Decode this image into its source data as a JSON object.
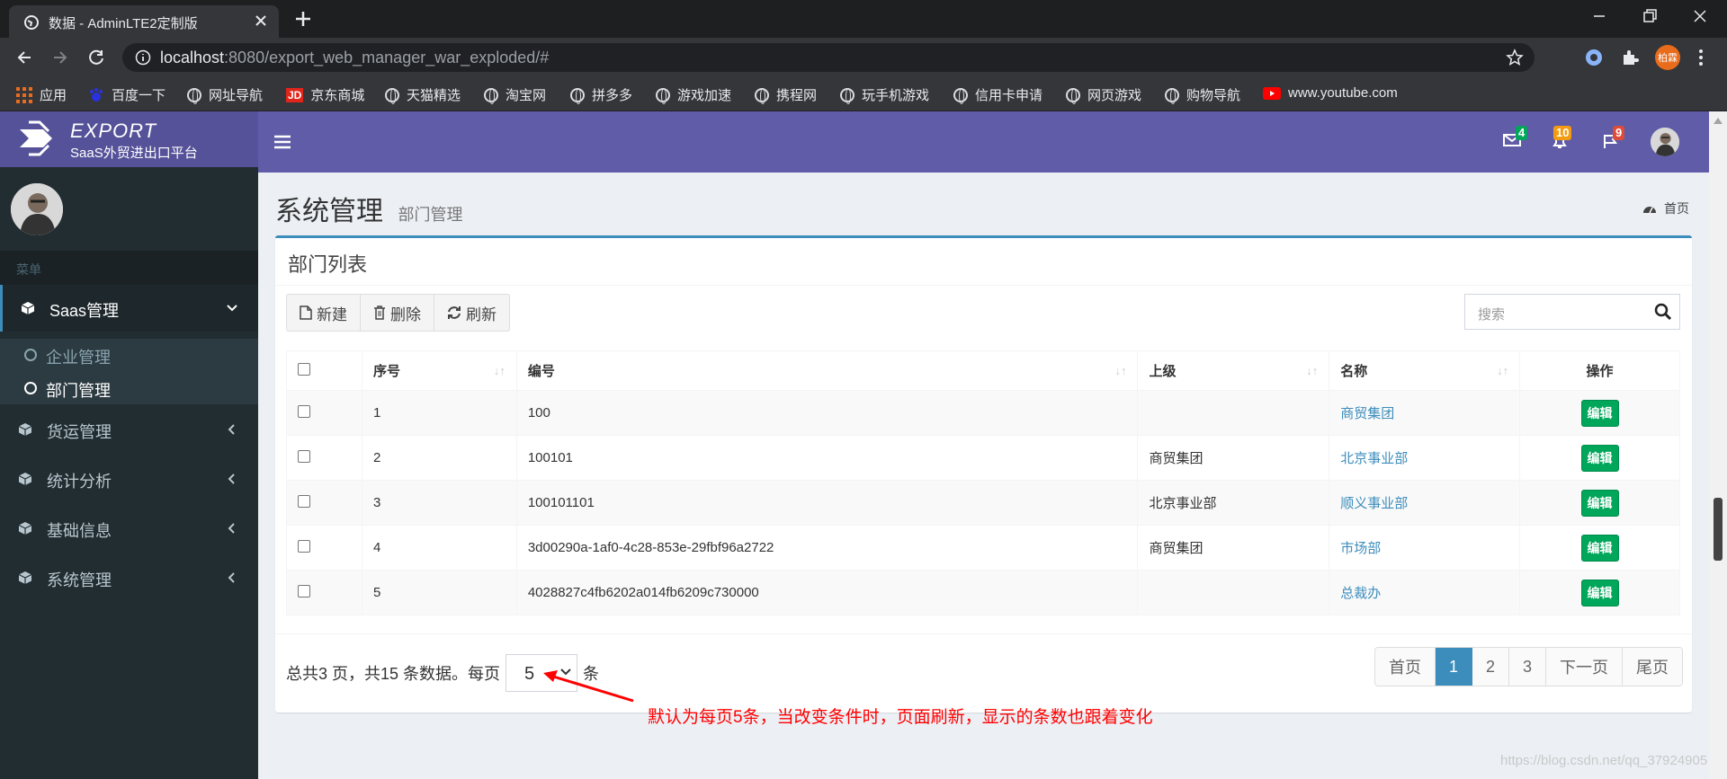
{
  "browser": {
    "tab_title": "数据 - AdminLTE2定制版",
    "url_host": "localhost",
    "url_rest": ":8080/export_web_manager_war_exploded/#",
    "profile_label": "柏霖",
    "bookmarks": [
      "应用",
      "百度一下",
      "网址导航",
      "京东商城",
      "天猫精选",
      "淘宝网",
      "拼多多",
      "游戏加速",
      "携程网",
      "玩手机游戏",
      "信用卡申请",
      "网页游戏",
      "购物导航",
      "www.youtube.com"
    ]
  },
  "logo": {
    "title": "EXPORT",
    "subtitle": "SaaS外贸进出口平台"
  },
  "sidebar": {
    "header": "菜单",
    "items": [
      {
        "label": "Saas管理"
      },
      {
        "label": "货运管理"
      },
      {
        "label": "统计分析"
      },
      {
        "label": "基础信息"
      },
      {
        "label": "系统管理"
      }
    ],
    "subitems": [
      {
        "label": "企业管理"
      },
      {
        "label": "部门管理"
      }
    ]
  },
  "topnav": {
    "mail_count": "4",
    "bell_count": "10",
    "flag_count": "9"
  },
  "content": {
    "title": "系统管理",
    "subtitle": "部门管理",
    "breadcrumb": "首页"
  },
  "box": {
    "title": "部门列表",
    "buttons": {
      "new": "新建",
      "delete": "删除",
      "refresh": "刷新"
    },
    "search_placeholder": "搜索",
    "columns": [
      "序号",
      "编号",
      "上级",
      "名称",
      "操作"
    ],
    "rows": [
      {
        "seq": "1",
        "code": "100",
        "parent": "",
        "name": "商贸集团",
        "op": "编辑"
      },
      {
        "seq": "2",
        "code": "100101",
        "parent": "商贸集团",
        "name": "北京事业部",
        "op": "编辑"
      },
      {
        "seq": "3",
        "code": "100101101",
        "parent": "北京事业部",
        "name": "顺义事业部",
        "op": "编辑"
      },
      {
        "seq": "4",
        "code": "3d00290a-1af0-4c28-853e-29fbf96a2722",
        "parent": "商贸集团",
        "name": "市场部",
        "op": "编辑"
      },
      {
        "seq": "5",
        "code": "4028827c4fb6202a014fb6209c730000",
        "parent": "",
        "name": "总裁办",
        "op": "编辑"
      }
    ],
    "pageinfo": {
      "prefix": "总共3 页，共15 条数据。每页",
      "per_page": "5",
      "suffix": "条"
    },
    "pagination": [
      "首页",
      "1",
      "2",
      "3",
      "下一页",
      "尾页"
    ]
  },
  "annotation": "默认为每页5条，当改变条件时，页面刷新，显示的条数也跟着变化",
  "watermark": "https://blog.csdn.net/qq_37924905"
}
